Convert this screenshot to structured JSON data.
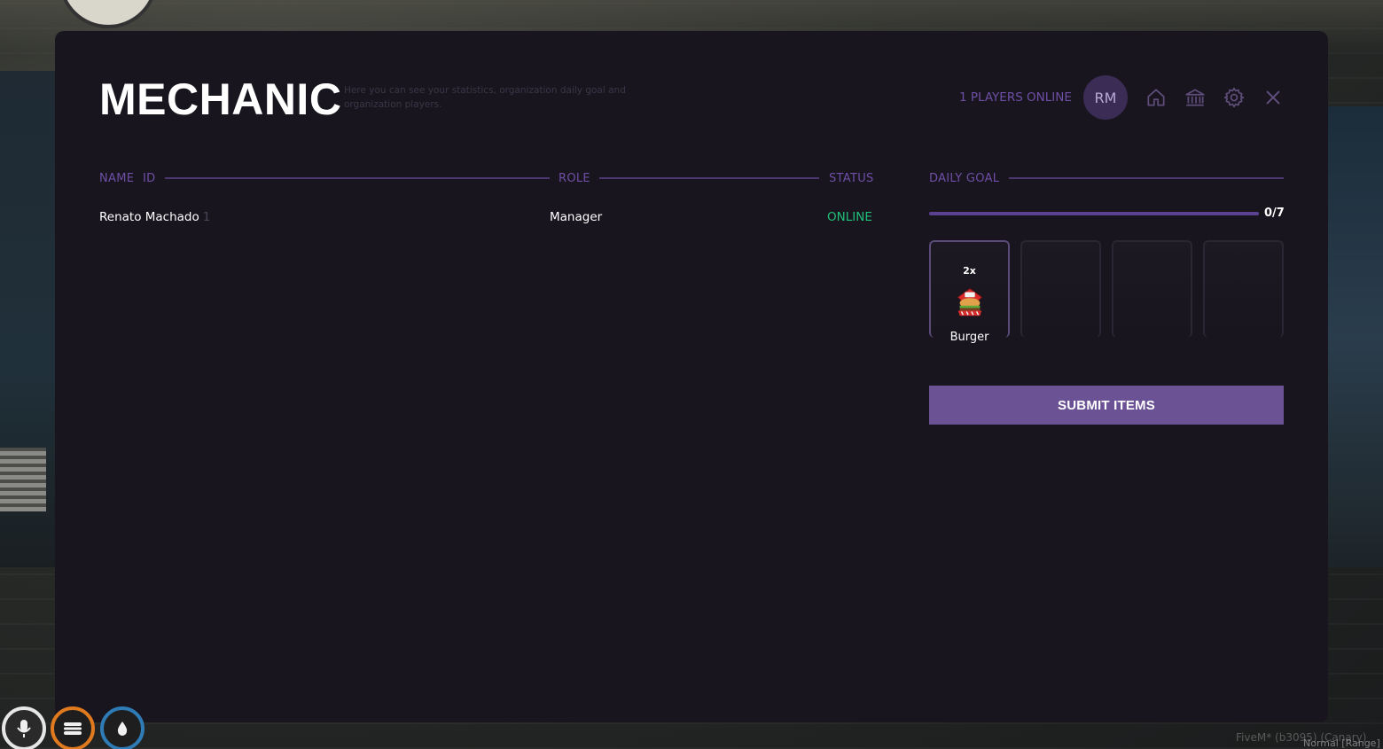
{
  "header": {
    "title": "MECHANIC",
    "subtitle": "Here you can see your statistics, organization daily goal and organization players.",
    "players_online": "1 PLAYERS ONLINE",
    "avatar_initials": "RM",
    "icons": [
      "home-icon",
      "bank-icon",
      "gear-icon",
      "close-icon"
    ]
  },
  "members": {
    "columns": {
      "name": "NAME",
      "id": "ID",
      "role": "ROLE",
      "status": "STATUS"
    },
    "rows": [
      {
        "name": "Renato Machado",
        "id": "1",
        "role": "Manager",
        "status": "ONLINE"
      }
    ]
  },
  "daily_goal": {
    "label": "DAILY GOAL",
    "progress_text": "0/7",
    "progress_fraction": 0,
    "items": [
      {
        "qty": "2x",
        "name": "Burger",
        "icon": "burger-icon"
      }
    ],
    "empty_slots": 3,
    "submit_label": "SUBMIT ITEMS"
  },
  "hud": {
    "icons": [
      "microphone-icon",
      "food-icon",
      "water-icon"
    ],
    "build_text": "FiveM* (b3095) (Canary)",
    "voice_text": "Normal [Range]"
  },
  "colors": {
    "panel_bg": "#18151e",
    "accent": "#6e4fa6",
    "button": "#6b5295",
    "online": "#21c07a"
  }
}
